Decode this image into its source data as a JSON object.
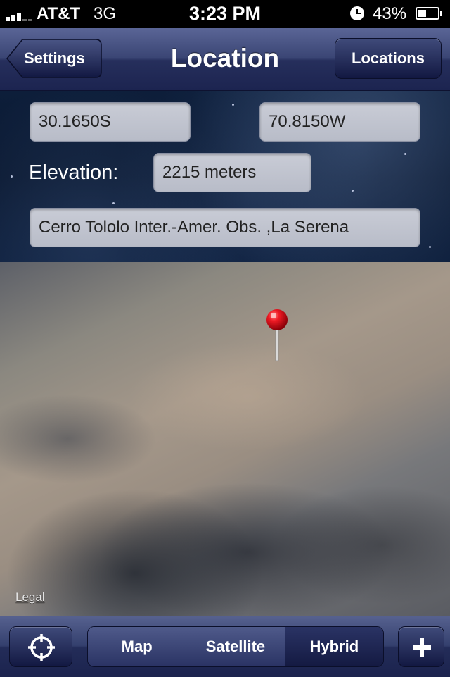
{
  "status_bar": {
    "carrier": "AT&T",
    "network": "3G",
    "time": "3:23 PM",
    "battery_percent": "43%",
    "battery_level": 0.43
  },
  "nav": {
    "back_label": "Settings",
    "title": "Location",
    "right_label": "Locations"
  },
  "location": {
    "latitude": "30.1650S",
    "longitude": "70.8150W",
    "elevation_label": "Elevation:",
    "elevation": "2215 meters",
    "name": "Cerro Tololo Inter.-Amer. Obs. ,La Serena"
  },
  "map": {
    "legal_label": "Legal",
    "pin_icon": "red-map-pin-icon"
  },
  "toolbar": {
    "locate_icon": "crosshair-icon",
    "map_types": [
      "Map",
      "Satellite",
      "Hybrid"
    ],
    "selected_map_type": "Hybrid",
    "add_icon": "plus-icon"
  },
  "colors": {
    "bar_navy": "#2a3364",
    "panel_night": "#0c1d3a",
    "pin_red": "#e0141e"
  }
}
